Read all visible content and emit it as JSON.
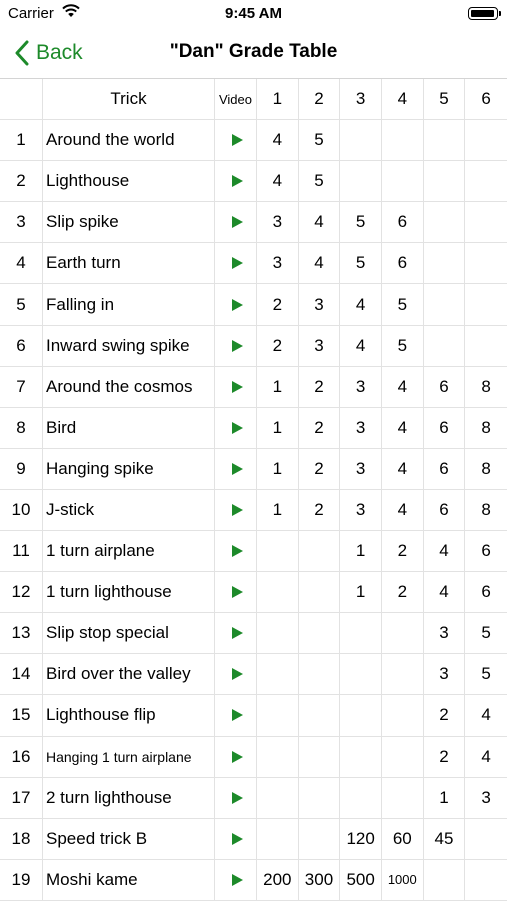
{
  "status": {
    "carrier": "Carrier",
    "time": "9:45 AM"
  },
  "nav": {
    "back_label": "Back",
    "title": "\"Dan\" Grade Table"
  },
  "table": {
    "headers": {
      "trick": "Trick",
      "video": "Video",
      "grades": [
        "1",
        "2",
        "3",
        "4",
        "5",
        "6"
      ]
    },
    "rows": [
      {
        "num": "1",
        "trick": "Around the world",
        "grades": [
          "4",
          "5",
          "",
          "",
          "",
          ""
        ]
      },
      {
        "num": "2",
        "trick": "Lighthouse",
        "grades": [
          "4",
          "5",
          "",
          "",
          "",
          ""
        ]
      },
      {
        "num": "3",
        "trick": "Slip spike",
        "grades": [
          "3",
          "4",
          "5",
          "6",
          "",
          ""
        ]
      },
      {
        "num": "4",
        "trick": "Earth turn",
        "grades": [
          "3",
          "4",
          "5",
          "6",
          "",
          ""
        ]
      },
      {
        "num": "5",
        "trick": "Falling in",
        "grades": [
          "2",
          "3",
          "4",
          "5",
          "",
          ""
        ]
      },
      {
        "num": "6",
        "trick": "Inward swing spike",
        "grades": [
          "2",
          "3",
          "4",
          "5",
          "",
          ""
        ]
      },
      {
        "num": "7",
        "trick": "Around the cosmos",
        "grades": [
          "1",
          "2",
          "3",
          "4",
          "6",
          "8"
        ]
      },
      {
        "num": "8",
        "trick": "Bird",
        "grades": [
          "1",
          "2",
          "3",
          "4",
          "6",
          "8"
        ]
      },
      {
        "num": "9",
        "trick": "Hanging spike",
        "grades": [
          "1",
          "2",
          "3",
          "4",
          "6",
          "8"
        ]
      },
      {
        "num": "10",
        "trick": "J-stick",
        "grades": [
          "1",
          "2",
          "3",
          "4",
          "6",
          "8"
        ]
      },
      {
        "num": "11",
        "trick": "1 turn airplane",
        "grades": [
          "",
          "",
          "1",
          "2",
          "4",
          "6"
        ]
      },
      {
        "num": "12",
        "trick": "1 turn lighthouse",
        "grades": [
          "",
          "",
          "1",
          "2",
          "4",
          "6"
        ]
      },
      {
        "num": "13",
        "trick": "Slip stop special",
        "grades": [
          "",
          "",
          "",
          "",
          "3",
          "5"
        ]
      },
      {
        "num": "14",
        "trick": "Bird over the valley",
        "grades": [
          "",
          "",
          "",
          "",
          "3",
          "5"
        ]
      },
      {
        "num": "15",
        "trick": "Lighthouse flip",
        "grades": [
          "",
          "",
          "",
          "",
          "2",
          "4"
        ]
      },
      {
        "num": "16",
        "trick": "Hanging 1 turn airplane",
        "grades": [
          "",
          "",
          "",
          "",
          "2",
          "4"
        ]
      },
      {
        "num": "17",
        "trick": "2 turn lighthouse",
        "grades": [
          "",
          "",
          "",
          "",
          "1",
          "3"
        ]
      },
      {
        "num": "18",
        "trick": "Speed trick B",
        "grades": [
          "",
          "",
          "120",
          "60",
          "45",
          ""
        ]
      },
      {
        "num": "19",
        "trick": "Moshi kame",
        "grades": [
          "200",
          "300",
          "500",
          "1000",
          "",
          ""
        ]
      }
    ]
  },
  "icons": {
    "back": "chevron-left-icon",
    "video": "play-icon",
    "wifi": "wifi-icon",
    "battery": "battery-icon"
  },
  "colors": {
    "accent": "#1d8a2a"
  }
}
